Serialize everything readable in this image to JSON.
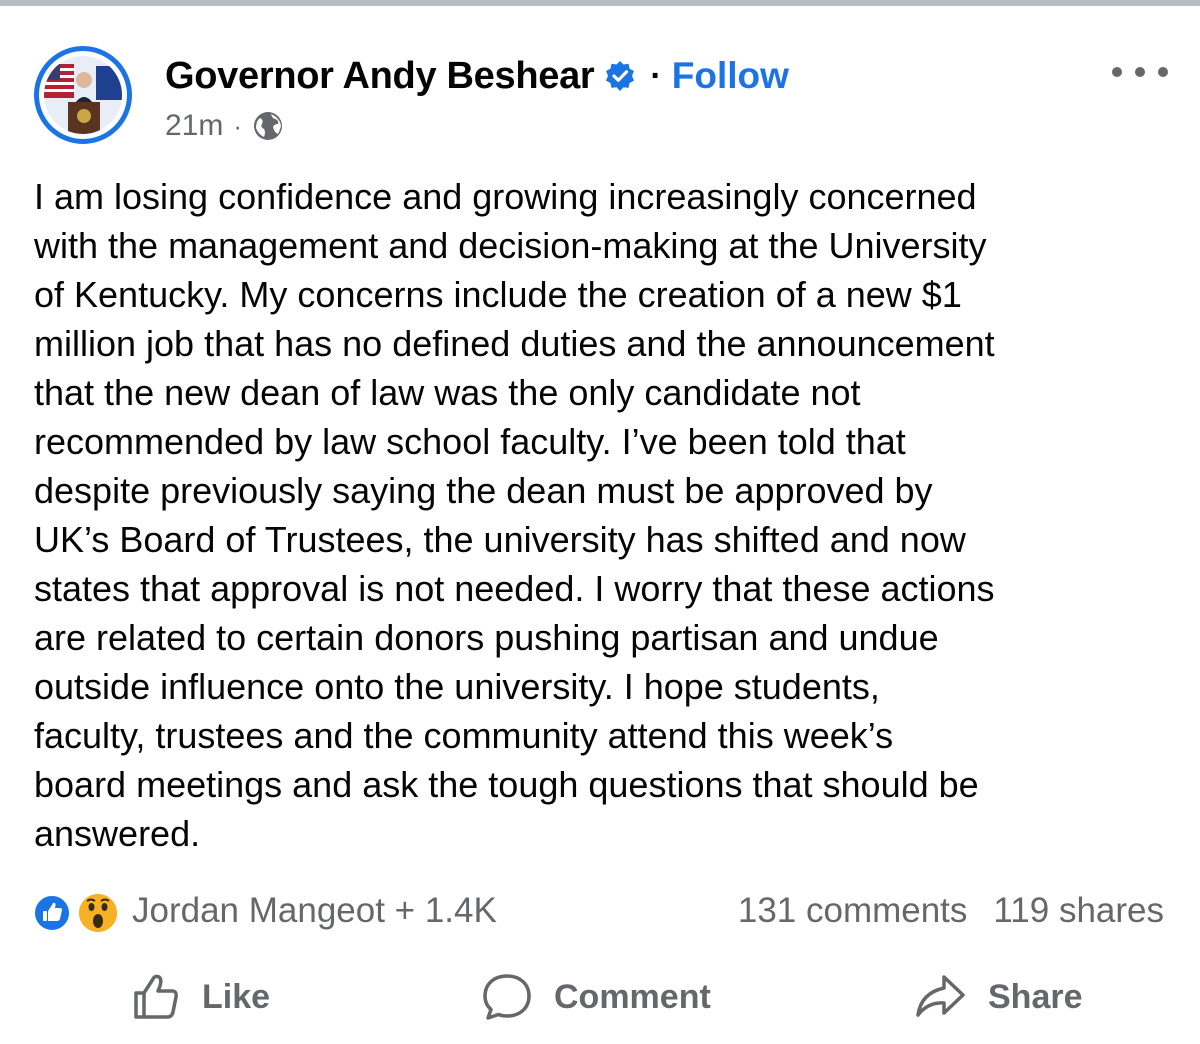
{
  "post": {
    "author": "Governor Andy Beshear",
    "follow_label": "Follow",
    "time": "21m",
    "body_lines": [
      "I am losing confidence and growing increasingly concerned",
      "with the management and decision-making at the University",
      "of Kentucky. My concerns include the creation of a new $1",
      "million job that has no defined duties and the announcement",
      "that the new dean of law was the only candidate not",
      "recommended by law school faculty. I’ve been told that",
      "despite previously saying the dean must be approved by",
      "UK’s Board of Trustees, the university has shifted and now",
      "states that approval is not needed. I worry that these actions",
      "are related to certain donors pushing partisan and undue",
      "outside influence onto the university. I hope students,",
      "faculty, trustees and the community attend this week’s",
      "board meetings and ask the tough questions that should be",
      "answered."
    ],
    "reactions_summary": "Jordan Mangeot + 1.4K",
    "comments_count": "131 comments",
    "shares_count": "119 shares"
  },
  "actions": {
    "like_label": "Like",
    "comment_label": "Comment",
    "share_label": "Share"
  },
  "icons": {
    "verified": "verified-badge-icon",
    "privacy": "globe-icon",
    "more": "more-options-icon",
    "reaction_1": "like-reaction-icon",
    "reaction_2": "wow-reaction-icon",
    "like": "thumbs-up-icon",
    "comment": "speech-bubble-icon",
    "share": "share-arrow-icon"
  },
  "colors": {
    "brand_blue": "#1b74e4",
    "secondary_text": "#65676b",
    "primary_text": "#050505"
  }
}
